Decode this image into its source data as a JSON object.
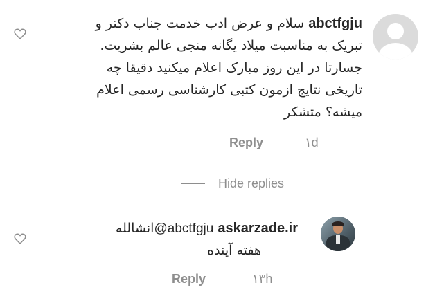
{
  "comment": {
    "username": "abctfgju",
    "lines": [
      "سلام و عرض ادب خدمت جناب دکتر و",
      "تبریک به مناسبت میلاد یگانه منجی عالم بشریت.",
      "جسارتا در این روز مبارک اعلام میکنید دقیقا چه",
      "تاریخی نتایج ازمون کتبی کارشناسی رسمی اعلام",
      "میشه؟ متشکر"
    ],
    "time": "۱d",
    "reply_label": "Reply",
    "avatar_icon": "default-avatar-icon",
    "like_icon": "heart-outline-icon"
  },
  "hide_replies_label": "Hide replies",
  "reply": {
    "username": "askarzade.ir",
    "mention": "@abctfgju",
    "text_after_mention": "انشالله",
    "line2": "هفته آینده",
    "time": "۱۳h",
    "reply_label": "Reply",
    "like_icon": "heart-outline-icon"
  },
  "colors": {
    "text": "#262626",
    "meta": "#8e8e8e",
    "avatar_placeholder": "#dbdbdb"
  }
}
